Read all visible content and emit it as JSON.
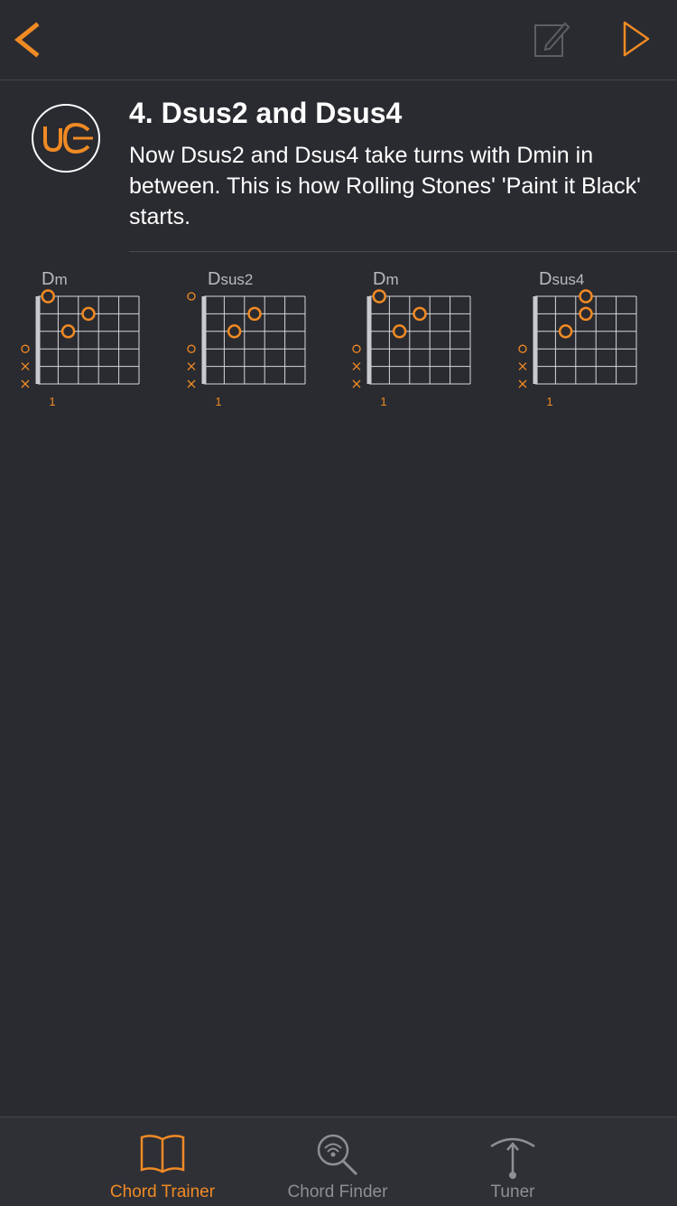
{
  "colors": {
    "accent": "#f08a24",
    "background": "#2a2b30",
    "muted": "#8e8f94"
  },
  "header": {
    "back_icon": "chevron-left-icon",
    "edit_icon": "edit-icon",
    "play_icon": "play-icon"
  },
  "lesson": {
    "title": "4. Dsus2 and Dsus4",
    "description": "Now Dsus2 and Dsus4 take turns with Dmin in between. This is how Rolling Stones' 'Paint it Black' starts."
  },
  "chords": [
    {
      "name": "Dm",
      "root": "D",
      "suffix": "m",
      "markers": [
        "",
        "",
        "",
        "o",
        "x",
        "x"
      ],
      "dots": [
        [
          0,
          1
        ],
        [
          1,
          3
        ],
        [
          2,
          2
        ]
      ],
      "fret_label": "1"
    },
    {
      "name": "Dsus2",
      "root": "D",
      "suffix": "sus2",
      "markers": [
        "o",
        "",
        "",
        "o",
        "x",
        "x"
      ],
      "dots": [
        [
          1,
          3
        ],
        [
          2,
          2
        ]
      ],
      "fret_label": "1"
    },
    {
      "name": "Dm",
      "root": "D",
      "suffix": "m",
      "markers": [
        "",
        "",
        "",
        "o",
        "x",
        "x"
      ],
      "dots": [
        [
          0,
          1
        ],
        [
          1,
          3
        ],
        [
          2,
          2
        ]
      ],
      "fret_label": "1"
    },
    {
      "name": "Dsus4",
      "root": "D",
      "suffix": "sus4",
      "markers": [
        "",
        "",
        "",
        "o",
        "x",
        "x"
      ],
      "dots": [
        [
          0,
          3
        ],
        [
          1,
          3
        ],
        [
          2,
          2
        ]
      ],
      "fret_label": "1"
    }
  ],
  "tabs": [
    {
      "label": "Chord Trainer",
      "icon": "book-icon",
      "active": true
    },
    {
      "label": "Chord Finder",
      "icon": "magnifier-icon",
      "active": false
    },
    {
      "label": "Tuner",
      "icon": "tuning-fork-icon",
      "active": false
    }
  ]
}
